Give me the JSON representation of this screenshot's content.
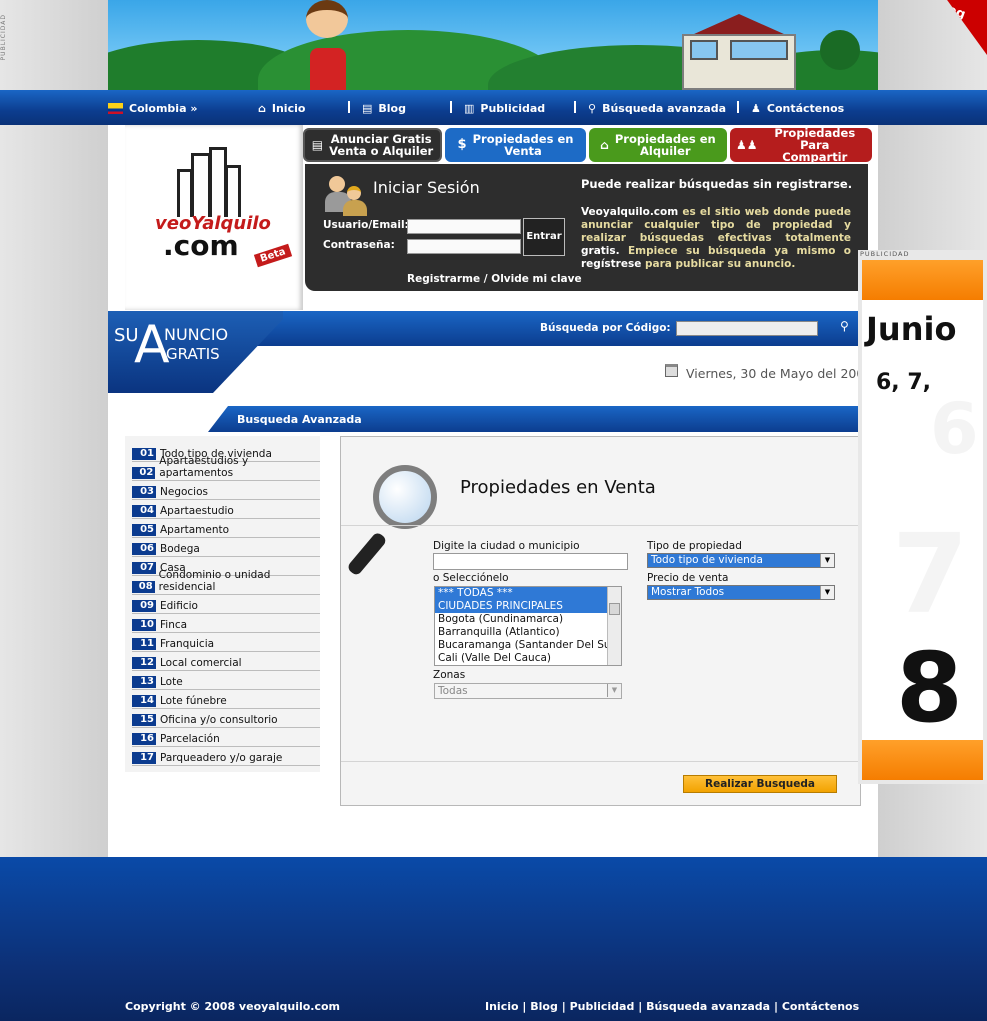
{
  "side_ad_label": "PUBLICIDAD",
  "banner": {
    "badge": "Blog de"
  },
  "nav": {
    "country": "Colombia »",
    "items": [
      {
        "label": "Inicio",
        "icon": "home-icon"
      },
      {
        "label": "Blog",
        "icon": "document-icon"
      },
      {
        "label": "Publicidad",
        "icon": "columns-icon"
      },
      {
        "label": "Búsqueda avanzada",
        "icon": "magnifier-icon"
      },
      {
        "label": "Contáctenos",
        "icon": "person-icon"
      }
    ]
  },
  "logo": {
    "line1": "veoYalquilo",
    "line2": ".com",
    "tag": "Beta"
  },
  "top_buttons": [
    {
      "label1": "Anunciar Gratis",
      "label2": "Venta o Alquiler",
      "color": "#2e2e2e"
    },
    {
      "label1": "Propiedades en",
      "label2": "Venta",
      "color": "#1d6bc6"
    },
    {
      "label1": "Propiedades en",
      "label2": "Alquiler",
      "color": "#4a9a1c"
    },
    {
      "label1": "Propiedades Para",
      "label2": "Compartir",
      "color": "#b51d1d"
    }
  ],
  "login": {
    "title": "Iniciar Sesión",
    "user_label": "Usuario/Email:",
    "pass_label": "Contraseña:",
    "submit": "Entrar",
    "register": "Registrarme",
    "forgot": "Olvide mi clave",
    "separator": "/",
    "headline": "Puede realizar búsquedas sin registrarse.",
    "body1_brand": "Veoyalquilo.com",
    "body1": "es el sitio web donde puede anunciar cualquier tipo de propiedad y realizar búsquedas efectivas totalmente",
    "body1_bold": "gratis.",
    "body2": "Empiece su búsqueda ya mismo o",
    "body2_bold": "regístrese",
    "body2_end": "para publicar su anuncio."
  },
  "code_search": {
    "label": "Búsqueda por Código:",
    "value": ""
  },
  "su_logo": {
    "su": "SU",
    "a": "A",
    "nuncio": "NUNCIO",
    "gratis": "GRATIS"
  },
  "date": "Viernes, 30 de Mayo del 200",
  "subheader": "Busqueda Avanzada",
  "categories": [
    {
      "num": "01",
      "label": "Todo tipo de vivienda"
    },
    {
      "num": "02",
      "label": "Apartaestudios y apartamentos"
    },
    {
      "num": "03",
      "label": "Negocios"
    },
    {
      "num": "04",
      "label": "Apartaestudio"
    },
    {
      "num": "05",
      "label": "Apartamento"
    },
    {
      "num": "06",
      "label": "Bodega"
    },
    {
      "num": "07",
      "label": "Casa"
    },
    {
      "num": "08",
      "label": "Condominio o unidad residencial"
    },
    {
      "num": "09",
      "label": "Edificio"
    },
    {
      "num": "10",
      "label": "Finca"
    },
    {
      "num": "11",
      "label": "Franquicia"
    },
    {
      "num": "12",
      "label": "Local comercial"
    },
    {
      "num": "13",
      "label": "Lote"
    },
    {
      "num": "14",
      "label": "Lote fúnebre"
    },
    {
      "num": "15",
      "label": "Oficina y/o consultorio"
    },
    {
      "num": "16",
      "label": "Parcelación"
    },
    {
      "num": "17",
      "label": "Parqueadero y/o garaje"
    }
  ],
  "panel": {
    "title": "Propiedades en Venta",
    "city_label": "Digite la ciudad o municipio",
    "city_value": "",
    "select_label": "o Selecciónelo",
    "cities": [
      "*** TODAS ***",
      "CIUDADES PRINCIPALES",
      "Bogota (Cundinamarca)",
      "Barranquilla (Atlantico)",
      "Bucaramanga (Santander Del Sur)",
      "Cali (Valle Del Cauca)"
    ],
    "zonas_label": "Zonas",
    "zonas_value": "Todas",
    "tipo_label": "Tipo de propiedad",
    "tipo_value": "Todo tipo de vivienda",
    "precio_label": "Precio de venta",
    "precio_value": "Mostrar Todos",
    "submit": "Realizar Busqueda"
  },
  "ad": {
    "label": "PUBLICIDAD",
    "month": "Junio",
    "days": "6, 7,",
    "big": "8",
    "bg1": "6",
    "bg2": "7"
  },
  "footer": {
    "copyright": "Copyright © 2008 veoyalquilo.com",
    "links": [
      "Inicio",
      "Blog",
      "Publicidad",
      "Búsqueda avanzada",
      "Contáctenos"
    ],
    "sep": "|"
  }
}
